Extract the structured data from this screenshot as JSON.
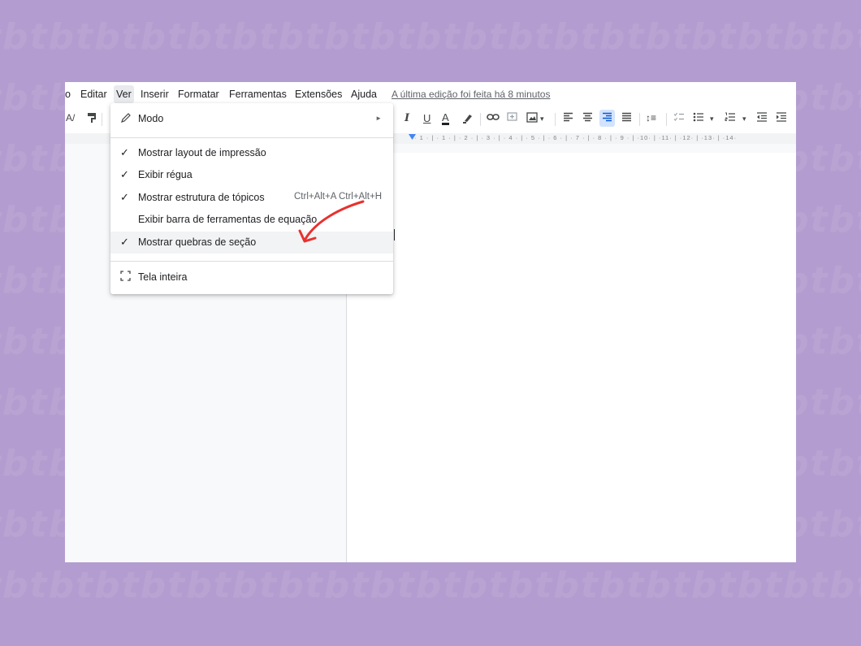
{
  "menubar": {
    "items": [
      {
        "label": "o"
      },
      {
        "label": "Editar"
      },
      {
        "label": "Ver"
      },
      {
        "label": "Inserir"
      },
      {
        "label": "Formatar"
      },
      {
        "label": "Ferramentas"
      },
      {
        "label": "Extensões"
      },
      {
        "label": "Ajuda"
      }
    ],
    "last_edit": "A última edição foi feita há 8 minutos"
  },
  "toolbar": {
    "italic": "I",
    "underline": "U",
    "text_color": "A",
    "line_spacing_icon": "↕≡",
    "more_glyph": "▾"
  },
  "ruler": {
    "marks": "· 1 · | · 1 · | · 2 · | · 3 · | · 4 · | · 5 · | · 6 · | · 7 · | · 8 · | · 9 · | ·10· | ·11· | ·12· | ·13· | ·14·"
  },
  "view_menu": {
    "mode": {
      "label": "Modo"
    },
    "items": [
      {
        "label": "Mostrar layout de impressão",
        "checked": true
      },
      {
        "label": "Exibir régua",
        "checked": true
      },
      {
        "label": "Mostrar estrutura de tópicos",
        "checked": true,
        "shortcut": "Ctrl+Alt+A Ctrl+Alt+H"
      },
      {
        "label": "Exibir barra de ferramentas de equação",
        "checked": false
      },
      {
        "label": "Mostrar quebras de seção",
        "checked": true
      }
    ],
    "fullscreen": {
      "label": "Tela inteira"
    },
    "check_glyph": "✓",
    "submenu_arrow": "►"
  },
  "colors": {
    "background": "#b39dd0",
    "annotation_arrow": "#e8312f",
    "ruler_indent": "#4285f4",
    "highlight": "#f1f3f4"
  }
}
